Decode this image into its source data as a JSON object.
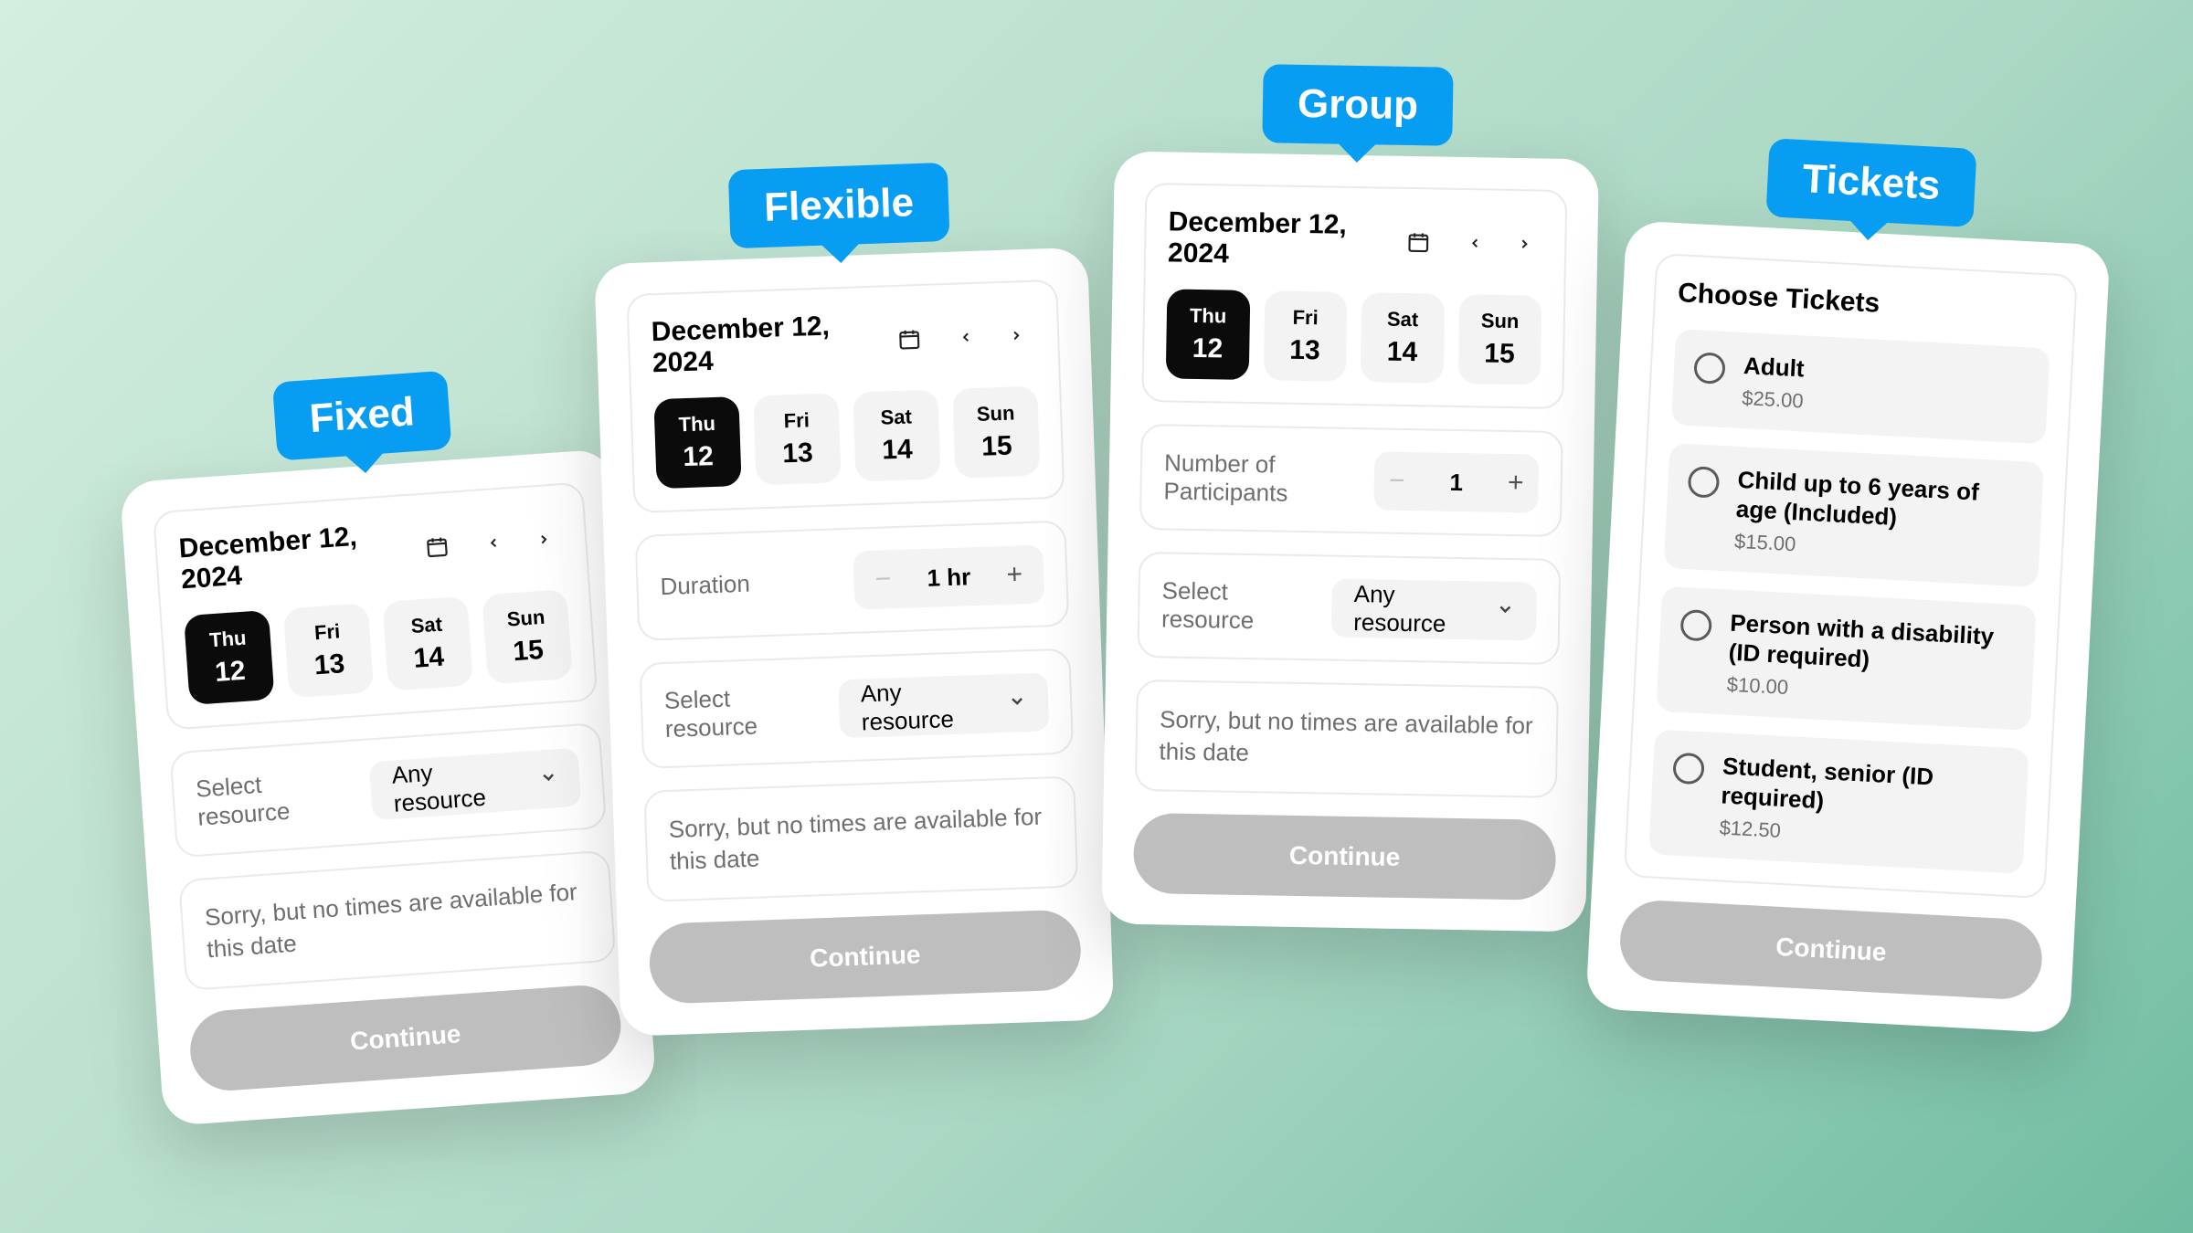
{
  "labels": {
    "fixed": "Fixed",
    "flexible": "Flexible",
    "group": "Group",
    "tickets": "Tickets"
  },
  "date": {
    "title": "December 12, 2024",
    "days": [
      {
        "dow": "Thu",
        "num": "12"
      },
      {
        "dow": "Fri",
        "num": "13"
      },
      {
        "dow": "Sat",
        "num": "14"
      },
      {
        "dow": "Sun",
        "num": "15"
      }
    ]
  },
  "flexible": {
    "duration_label": "Duration",
    "duration_value": "1 hr",
    "resource_label": "Select resource",
    "resource_value": "Any resource"
  },
  "group": {
    "participants_label": "Number of Participants",
    "participants_value": "1",
    "resource_label": "Select resource",
    "resource_value": "Any resource"
  },
  "fixed": {
    "resource_label": "Select resource",
    "resource_value": "Any resource"
  },
  "common": {
    "no_times": "Sorry, but no times are available for this date",
    "continue": "Continue"
  },
  "tickets": {
    "heading": "Choose Tickets",
    "items": [
      {
        "name": "Adult",
        "price": "$25.00"
      },
      {
        "name": "Child up to 6 years of age (Included)",
        "price": "$15.00"
      },
      {
        "name": "Person with a disability (ID required)",
        "price": "$10.00"
      },
      {
        "name": "Student, senior (ID required)",
        "price": "$12.50"
      }
    ]
  }
}
